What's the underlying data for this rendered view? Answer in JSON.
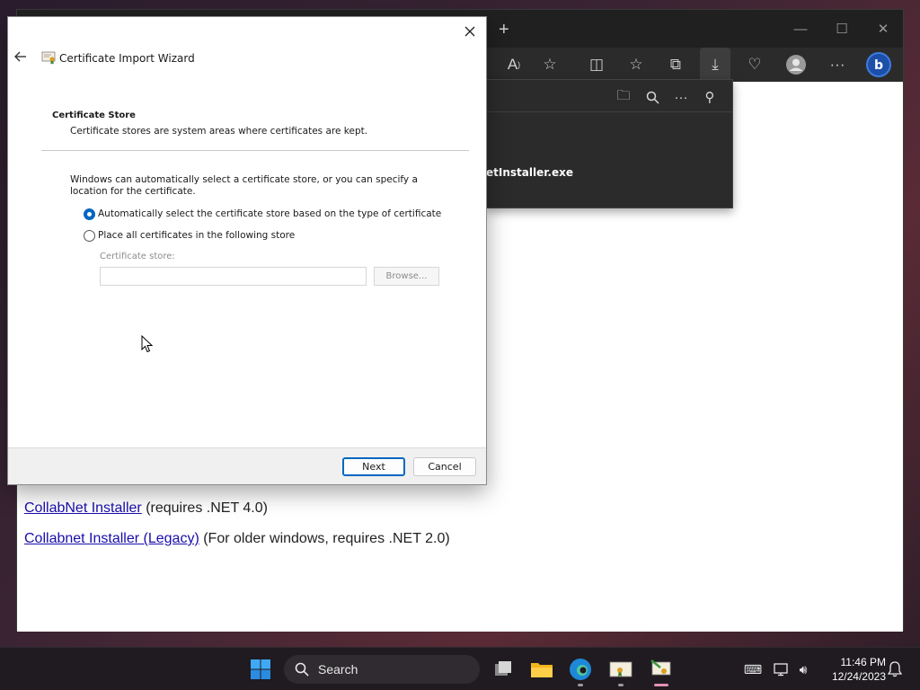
{
  "browser": {
    "content_lines": [
      {
        "link": "CollabNet Installer",
        "note": "(requires .NET 4.0)"
      },
      {
        "link": "Collabnet Installer (Legacy)",
        "note": "(For older windows, requires .NET 2.0)"
      }
    ],
    "toolbar_icons": [
      "read-aloud-icon",
      "favorite-star-icon",
      "split-screen-icon",
      "favorites-icon",
      "collections-icon",
      "downloads-icon",
      "browser-essentials-icon",
      "profile-icon",
      "more-icon",
      "bing-copilot-icon"
    ]
  },
  "downloads_panel": {
    "file_name_visible": "etInstaller.exe",
    "icons": [
      "open-folder-icon",
      "search-icon",
      "more-icon",
      "pin-icon"
    ]
  },
  "dialog": {
    "title": "Certificate Import Wizard",
    "section_title": "Certificate Store",
    "section_description": "Certificate stores are system areas where certificates are kept.",
    "intro": "Windows can automatically select a certificate store, or you can specify a location for the certificate.",
    "options": [
      {
        "label": "Automatically select the certificate store based on the type of certificate",
        "selected": true
      },
      {
        "label": "Place all certificates in the following store",
        "selected": false
      }
    ],
    "store_label": "Certificate store:",
    "store_value": "",
    "browse_label": "Browse...",
    "next_label": "Next",
    "cancel_label": "Cancel"
  },
  "taskbar": {
    "search_label": "Search",
    "time": "11:46 PM",
    "date": "12/24/2023",
    "apps": [
      "start-button",
      "task-view",
      "file-explorer",
      "edge",
      "certificate-app",
      "wizard-app"
    ],
    "tray": [
      "keyboard-icon",
      "network-icon",
      "volume-icon",
      "notification-bell-icon"
    ]
  },
  "colors": {
    "accent": "#0067c0",
    "link": "#1a0dab",
    "browser_chrome": "#202020",
    "taskbar": "#1f1b20"
  }
}
